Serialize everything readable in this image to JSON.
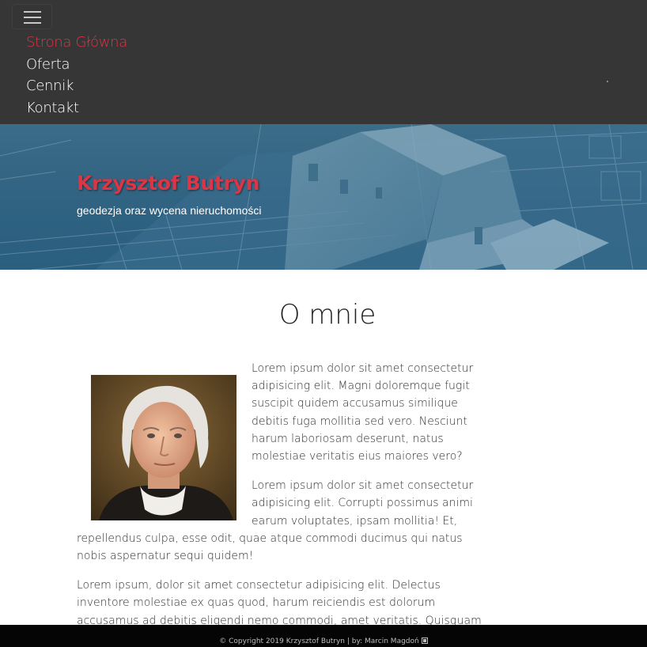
{
  "nav": {
    "toggle_icon": "hamburger-menu-icon",
    "items": [
      {
        "label": "Strona Główna",
        "active": true
      },
      {
        "label": "Oferta",
        "active": false
      },
      {
        "label": "Cennik",
        "active": false
      },
      {
        "label": "Kontakt",
        "active": false
      }
    ]
  },
  "hero": {
    "title": "Krzysztof Butryn",
    "subtitle": "geodezja oraz wycena nieruchomości"
  },
  "about": {
    "heading": "O mnie",
    "paragraphs": [
      "Lorem ipsum dolor sit amet consectetur adipisicing elit. Magni doloremque fugit suscipit quidem accusamus similique debitis fuga mollitia sed vero. Nesciunt harum laboriosam deserunt, natus molestiae veritatis eius maiores vero?",
      "Lorem ipsum dolor sit amet consectetur adipisicing elit. Corrupti possimus animi earum voluptates, ipsam mollitia! Et, repellendus culpa, esse odit, quae atque commodi ducimus qui natus nobis aspernatur sequi quidem!",
      "Lorem ipsum, dolor sit amet consectetur adipisicing elit. Delectus inventore molestiae ex quas quod, harum reiciendis est dolorum accusamus ad debitis eligendi nemo commodi, amet veritatis. Quisquam animi dolores reprehenderit?"
    ]
  },
  "footer": {
    "text": "© Copyright 2019 Krzysztof Butryn | by: Marcin Magdoń",
    "icon": "external-link-icon"
  },
  "colors": {
    "nav_bg": "#363636",
    "accent": "#dc3545",
    "hero_overlay": "#2f6281",
    "footer_bg": "#050505"
  }
}
